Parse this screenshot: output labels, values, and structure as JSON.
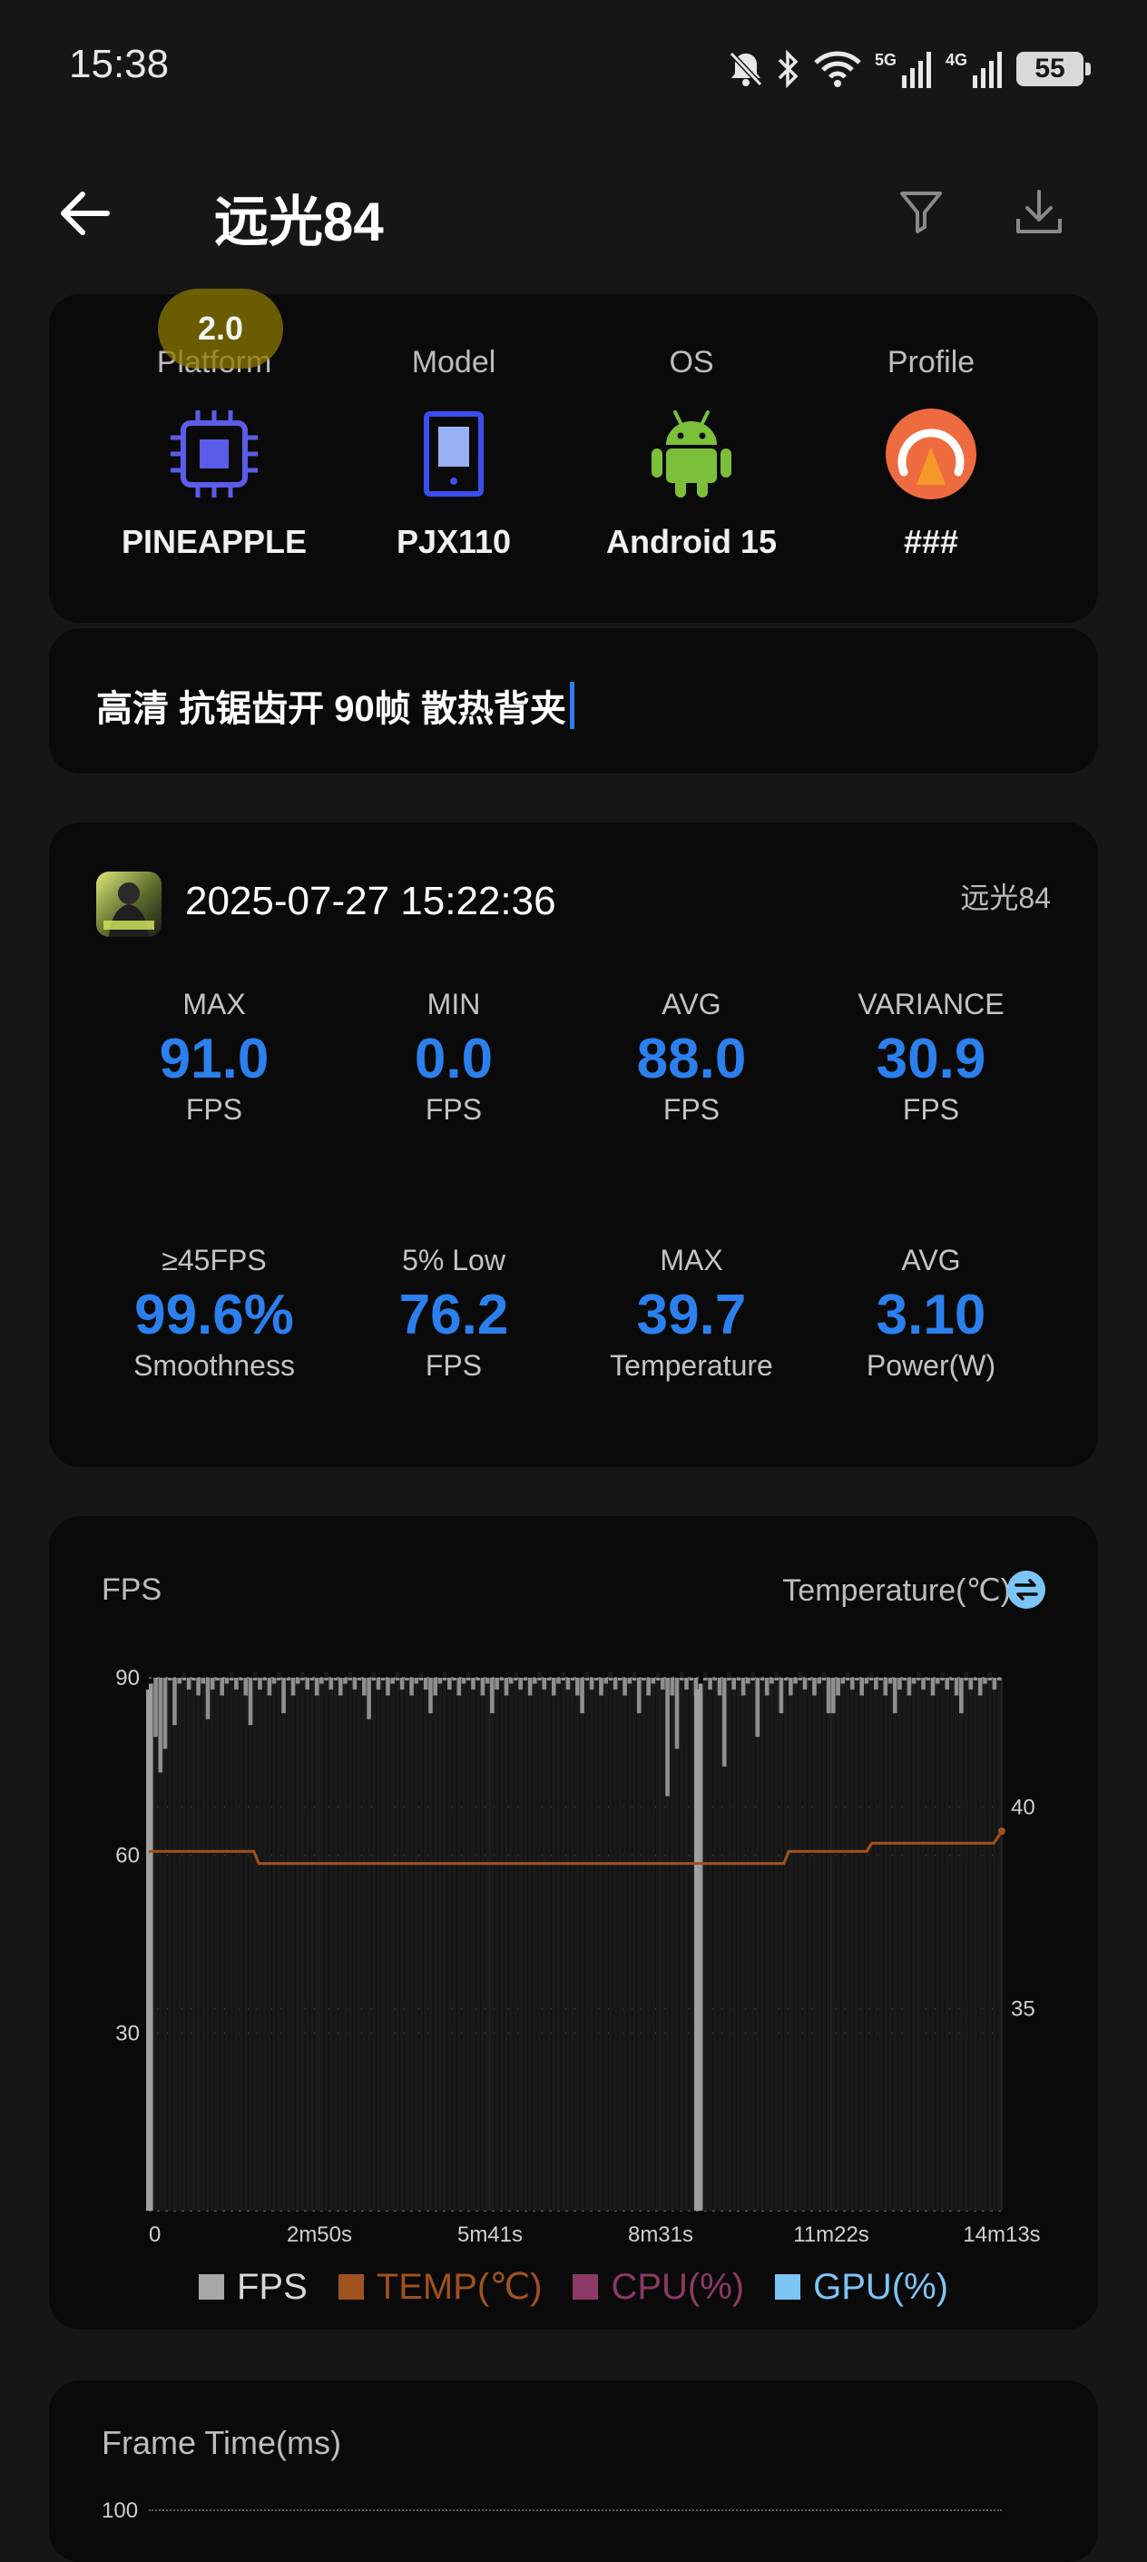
{
  "status_bar": {
    "time": "15:38",
    "network_5g": "5G",
    "network_4g": "4G",
    "battery": "55",
    "icons": [
      "bell-off-icon",
      "bluetooth-icon",
      "wifi-icon",
      "signal-5g-icon",
      "signal-4g-icon",
      "battery-icon"
    ]
  },
  "header": {
    "title": "远光84",
    "icons": [
      "back-arrow-icon",
      "filter-icon",
      "download-icon"
    ]
  },
  "device": {
    "badge": "2.0",
    "columns": [
      {
        "label": "Platform",
        "value": "PINEAPPLE",
        "icon": "chip-icon"
      },
      {
        "label": "Model",
        "value": "PJX110",
        "icon": "phone-icon"
      },
      {
        "label": "OS",
        "value": "Android 15",
        "icon": "android-icon"
      },
      {
        "label": "Profile",
        "value": "###",
        "icon": "gauge-icon"
      }
    ]
  },
  "note": {
    "text": "高清 抗锯齿开 90帧 散热背夹"
  },
  "session": {
    "datetime": "2025-07-27 15:22:36",
    "game": "远光84",
    "stats": [
      {
        "label": "MAX",
        "value": "91.0",
        "unit": "FPS"
      },
      {
        "label": "MIN",
        "value": "0.0",
        "unit": "FPS"
      },
      {
        "label": "AVG",
        "value": "88.0",
        "unit": "FPS"
      },
      {
        "label": "VARIANCE",
        "value": "30.9",
        "unit": "FPS"
      },
      {
        "label": "≥45FPS",
        "value": "99.6%",
        "unit": "Smoothness"
      },
      {
        "label": "5% Low",
        "value": "76.2",
        "unit": "FPS"
      },
      {
        "label": "MAX",
        "value": "39.7",
        "unit": "Temperature"
      },
      {
        "label": "AVG",
        "value": "3.10",
        "unit": "Power(W)"
      }
    ]
  },
  "chart_section": {
    "title_left": "FPS",
    "title_right": "Temperature(℃)",
    "colors": {
      "fps": "#8a8a8a",
      "temp": "#a0521e",
      "cpu": "#8b3a66",
      "gpu": "#7cc6f5"
    }
  },
  "chart_data": {
    "type": "bar",
    "title": "FPS",
    "y_left_ticks": [
      "90",
      "60",
      "30"
    ],
    "y_left_range": [
      0,
      90
    ],
    "y_right_ticks": [
      "40",
      "35"
    ],
    "y_right_label": "Temperature(℃)",
    "x_ticks": [
      "0",
      "2m50s",
      "5m41s",
      "8m31s",
      "11m22s",
      "14m13s"
    ],
    "x_range_seconds": [
      0,
      853
    ],
    "series": [
      {
        "name": "FPS",
        "baseline": 88,
        "dips": [
          {
            "t": 0,
            "fps": 0
          },
          {
            "t": 5,
            "fps": 80
          },
          {
            "t": 10,
            "fps": 74
          },
          {
            "t": 15,
            "fps": 78
          },
          {
            "t": 22,
            "fps": 82
          },
          {
            "t": 55,
            "fps": 83
          },
          {
            "t": 98,
            "fps": 82
          },
          {
            "t": 133,
            "fps": 84
          },
          {
            "t": 220,
            "fps": 83
          },
          {
            "t": 280,
            "fps": 84
          },
          {
            "t": 340,
            "fps": 84
          },
          {
            "t": 430,
            "fps": 84
          },
          {
            "t": 490,
            "fps": 84
          },
          {
            "t": 518,
            "fps": 70
          },
          {
            "t": 528,
            "fps": 78
          },
          {
            "t": 548,
            "fps": 0
          },
          {
            "t": 575,
            "fps": 75
          },
          {
            "t": 605,
            "fps": 80
          },
          {
            "t": 630,
            "fps": 84
          },
          {
            "t": 680,
            "fps": 84
          },
          {
            "t": 745,
            "fps": 84
          },
          {
            "t": 810,
            "fps": 84
          }
        ]
      },
      {
        "name": "TEMP(℃)",
        "points": [
          {
            "t": 0,
            "temp": 38.9
          },
          {
            "t": 105,
            "temp": 38.9
          },
          {
            "t": 110,
            "temp": 38.6
          },
          {
            "t": 635,
            "temp": 38.6
          },
          {
            "t": 640,
            "temp": 38.9
          },
          {
            "t": 718,
            "temp": 38.9
          },
          {
            "t": 723,
            "temp": 39.1
          },
          {
            "t": 845,
            "temp": 39.1
          },
          {
            "t": 853,
            "temp": 39.4
          }
        ]
      }
    ],
    "legend": [
      "FPS",
      "TEMP(℃)",
      "CPU(%)",
      "GPU(%)"
    ]
  },
  "frame_time": {
    "title": "Frame Time(ms)",
    "tick_top": "100"
  }
}
